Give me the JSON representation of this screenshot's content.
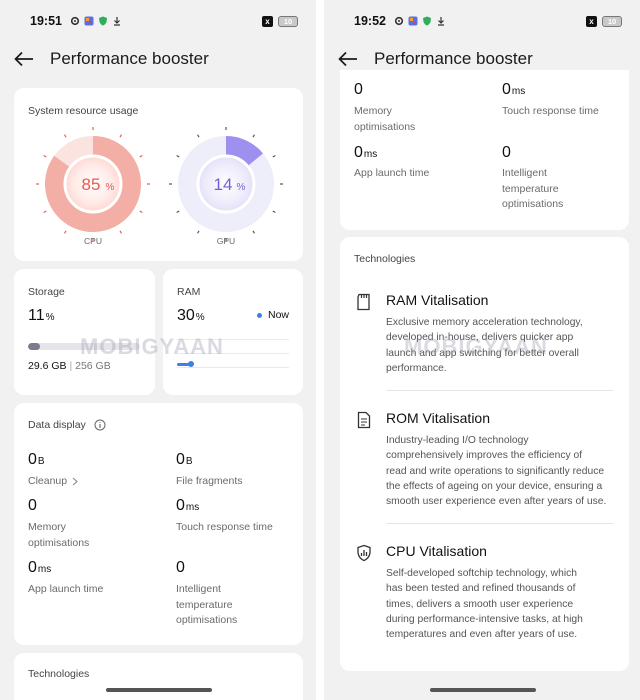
{
  "left": {
    "status": {
      "time": "19:51",
      "battery": "10"
    },
    "header": {
      "title": "Performance booster"
    },
    "system": {
      "title": "System resource usage",
      "cpu": {
        "value": "85",
        "unit": "%",
        "label": "CPU",
        "level": 0.85
      },
      "gpu": {
        "value": "14",
        "unit": "%",
        "label": "GPU",
        "level": 0.14
      }
    },
    "storage": {
      "title": "Storage",
      "value": "11",
      "unit": "%",
      "used": "29.6 GB",
      "sep": "|",
      "total": "256 GB",
      "level": 0.11
    },
    "ram": {
      "title": "RAM",
      "value": "30",
      "unit": "%",
      "now": "Now"
    },
    "data_display": {
      "title": "Data display",
      "cleanup": {
        "value": "0",
        "unit": "B",
        "label": "Cleanup"
      },
      "fragments": {
        "value": "0",
        "unit": "B",
        "label": "File fragments"
      },
      "memopt": {
        "value": "0",
        "label1": "Memory",
        "label2": "optimisations"
      },
      "touch": {
        "value": "0",
        "unit": "ms",
        "label": "Touch response time"
      },
      "launch": {
        "value": "0",
        "unit": "ms",
        "label": "App launch time"
      },
      "temp": {
        "value": "0",
        "label1": "Intelligent",
        "label2": "temperature",
        "label3": "optimisations"
      }
    },
    "technologies_title": "Technologies",
    "watermark": "MOBIGYAAN"
  },
  "right": {
    "status": {
      "time": "19:52",
      "battery": "10"
    },
    "header": {
      "title": "Performance booster"
    },
    "memopt": {
      "value": "0",
      "label1": "Memory",
      "label2": "optimisations"
    },
    "touch": {
      "value": "0",
      "unit": "ms",
      "label": "Touch response time"
    },
    "launch": {
      "value": "0",
      "unit": "ms",
      "label": "App launch time"
    },
    "temp": {
      "value": "0",
      "label1": "Intelligent",
      "label2": "temperature",
      "label3": "optimisations"
    },
    "technologies": {
      "title": "Technologies",
      "items": [
        {
          "title": "RAM Vitalisation",
          "icon": "memory-card-icon",
          "lines": [
            "Exclusive memory acceleration technology,",
            "developed in-house, delivers quicker app",
            "launch and app switching for better overall",
            "performance."
          ]
        },
        {
          "title": "ROM Vitalisation",
          "icon": "document-icon",
          "lines": [
            "Industry-leading I/O technology",
            "comprehensively improves the efficiency of",
            "read and write operations to significantly reduce",
            "the effects of ageing on your device, ensuring a",
            "smooth user experience even after years of use."
          ]
        },
        {
          "title": "CPU Vitalisation",
          "icon": "shield-chart-icon",
          "lines": [
            "Self-developed softchip technology, which",
            "has been tested and refined thousands of",
            "times, delivers a smooth user experience",
            "during performance-intensive tasks, at high",
            "temperatures and even after years of use."
          ]
        }
      ]
    },
    "watermark": "MOBIGYAAN"
  },
  "colors": {
    "cpu": "#e85a50",
    "gpu": "#8a7ce8",
    "accent": "#3f7ee8",
    "background": "#f1f1f1"
  }
}
